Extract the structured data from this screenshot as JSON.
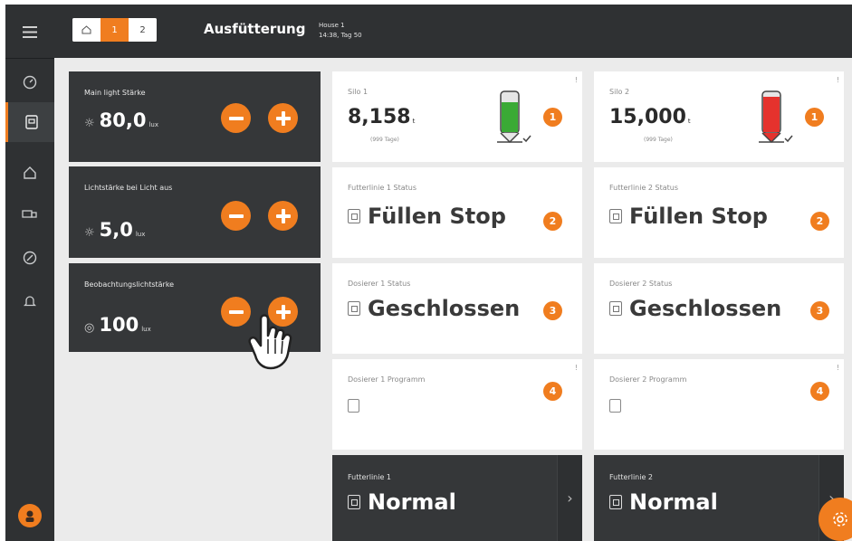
{
  "header": {
    "house_tabs": [
      "1",
      "2"
    ],
    "title": "Ausfütterung",
    "house_name": "House 1",
    "house_time": "14:38, Tag 50"
  },
  "sidebar": {
    "icons": [
      "menu-icon",
      "dashboard-icon",
      "house-icon",
      "barn-icon",
      "truck-icon",
      "gauge-icon",
      "bell-icon"
    ],
    "active_index": 1
  },
  "lights": [
    {
      "label": "Main light Stärke",
      "value": "80,0",
      "unit": "lux",
      "icon": "bulb-icon"
    },
    {
      "label": "Lichtstärke bei Licht aus",
      "value": "5,0",
      "unit": "lux",
      "icon": "bulb-icon"
    },
    {
      "label": "Beobachtungslichtstärke",
      "value": "100",
      "unit": "lux",
      "icon": "camera-icon"
    }
  ],
  "silos": [
    {
      "label": "Silo 1",
      "value": "8,158",
      "unit": "t",
      "days": "(999 Tage)",
      "badge": "1",
      "fill_color": "#3aaa35",
      "fill_level": 0.7
    },
    {
      "label": "Silo 2",
      "value": "15,000",
      "unit": "t",
      "days": "(999 Tage)",
      "badge": "1",
      "fill_color": "#e5322d",
      "fill_level": 0.85
    }
  ],
  "feedlines_status": [
    {
      "label": "Futterlinie 1 Status",
      "value": "Füllen Stop",
      "badge": "2"
    },
    {
      "label": "Futterlinie 2 Status",
      "value": "Füllen Stop",
      "badge": "2"
    }
  ],
  "dosers_status": [
    {
      "label": "Dosierer 1 Status",
      "value": "Geschlossen",
      "badge": "3"
    },
    {
      "label": "Dosierer 2 Status",
      "value": "Geschlossen",
      "badge": "3"
    }
  ],
  "dosers_program": [
    {
      "label": "Dosierer 1 Programm",
      "badge": "4"
    },
    {
      "label": "Dosierer 2 Programm",
      "badge": "4"
    }
  ],
  "feedlines_mode": [
    {
      "label": "Futterlinie 1",
      "value": "Normal"
    },
    {
      "label": "Futterlinie 2",
      "value": "Normal"
    }
  ],
  "colors": {
    "accent": "#f07d1f",
    "dark": "#2f3133",
    "panel": "#353739",
    "background": "#ebebeb"
  }
}
